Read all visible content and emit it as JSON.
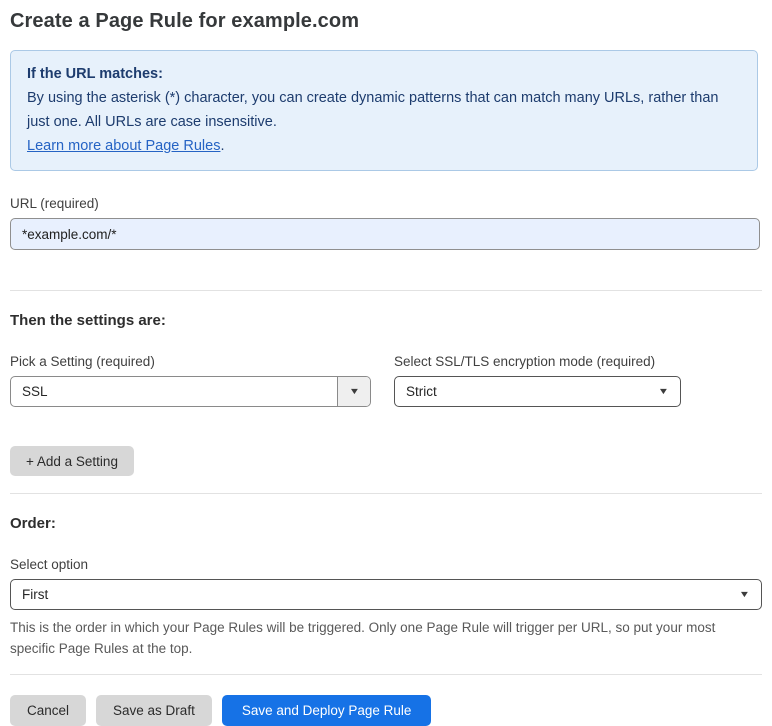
{
  "page": {
    "title": "Create a Page Rule for example.com"
  },
  "info_box": {
    "heading": "If the URL matches:",
    "body": "By using the asterisk (*) character, you can create dynamic patterns that can match many URLs, rather than just one. All URLs are case insensitive.",
    "link": "Learn more about Page Rules",
    "link_suffix": "."
  },
  "url_field": {
    "label": "URL (required)",
    "value": "*example.com/*"
  },
  "settings_section": {
    "heading": "Then the settings are:",
    "setting_select": {
      "label": "Pick a Setting (required)",
      "value": "SSL"
    },
    "mode_select": {
      "label": "Select SSL/TLS encryption mode (required)",
      "value": "Strict"
    },
    "add_setting_label": "+ Add a Setting"
  },
  "order_section": {
    "heading": "Order:",
    "select_label": "Select option",
    "value": "First",
    "help_text": "This is the order in which your Page Rules will be triggered. Only one Page Rule will trigger per URL, so put your most specific Page Rules at the top."
  },
  "footer": {
    "cancel_label": "Cancel",
    "save_draft_label": "Save as Draft",
    "save_deploy_label": "Save and Deploy Page Rule"
  },
  "icons": {
    "dropdown_caret": "▼"
  },
  "colors": {
    "info_box_bg": "#e7f1fb",
    "info_box_border": "#abc9e6",
    "info_text": "#1d3c6e",
    "link_blue": "#2563c4",
    "url_input_bg": "#e8f0fe",
    "primary_button_blue": "#1672e6",
    "gray_button_bg": "#d7d7d7",
    "divider_gray": "#e2e2e2"
  }
}
